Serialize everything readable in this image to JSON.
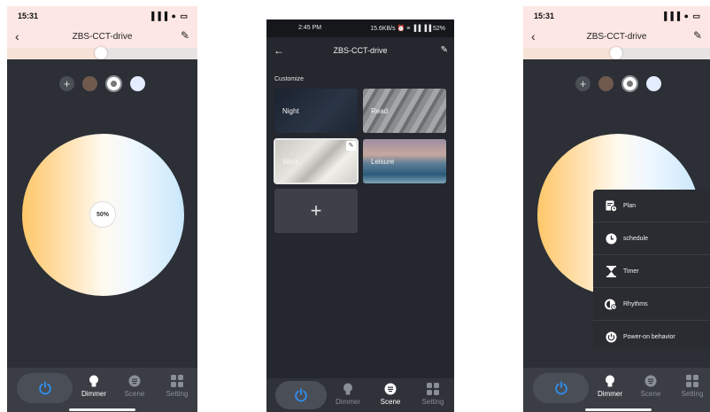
{
  "phone1": {
    "time": "15:31",
    "status_icons": "▐▐▐ ● ▭",
    "title": "ZBS-CCT-drive",
    "brightness_label": "50%",
    "tabs": {
      "dimmer": "Dimmer",
      "scene": "Scene",
      "setting": "Setting"
    }
  },
  "phone2": {
    "time": "2:45 PM",
    "status_right": "15.6KB/s ⏰ ≡ ▐▐ ▐▐ 52%",
    "title": "ZBS-CCT-drive",
    "section": "Customize",
    "scenes": [
      {
        "label": "Night"
      },
      {
        "label": "Read"
      },
      {
        "label": "Work"
      },
      {
        "label": "Leisure"
      }
    ],
    "add_symbol": "+",
    "tabs": {
      "dimmer": "Dimmer",
      "scene": "Scene",
      "setting": "Setting"
    }
  },
  "phone3": {
    "time": "15:31",
    "status_icons": "▐▐▐ ● ▭",
    "title": "ZBS-CCT-drive",
    "menu": [
      {
        "label": "Plan",
        "icon": "plan-icon"
      },
      {
        "label": "schedule",
        "icon": "clock-icon"
      },
      {
        "label": "Timer",
        "icon": "hourglass-icon"
      },
      {
        "label": "Rhythms",
        "icon": "rhythm-icon"
      },
      {
        "label": "Power-on behavior",
        "icon": "power-on-icon"
      }
    ],
    "tabs": {
      "dimmer": "Dimmer",
      "scene": "Scene",
      "setting": "Setting"
    }
  },
  "colors": {
    "accent_blue": "#2f8ff0",
    "dark_bg": "#2c2f36",
    "tab_bg": "#3a3d44",
    "header_pink": "#fde7e4"
  }
}
